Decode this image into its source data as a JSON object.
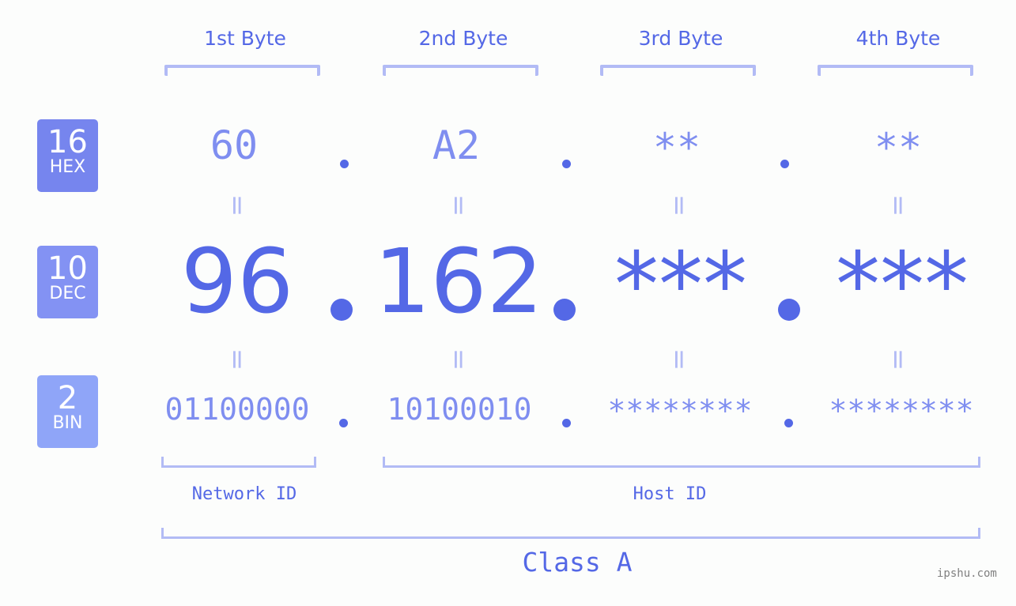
{
  "byte_headers": [
    "1st Byte",
    "2nd Byte",
    "3rd Byte",
    "4th Byte"
  ],
  "rows": {
    "hex": {
      "base": "16",
      "name": "HEX",
      "color": "#7685ee",
      "values": [
        "60",
        "A2",
        "**",
        "**"
      ]
    },
    "dec": {
      "base": "10",
      "name": "DEC",
      "color": "#8392f3",
      "values": [
        "96",
        "162",
        "***",
        "***"
      ]
    },
    "bin": {
      "base": "2",
      "name": "BIN",
      "color": "#8fa5f8",
      "values": [
        "01100000",
        "10100010",
        "********",
        "********"
      ]
    }
  },
  "equals_symbol": "=",
  "segments": {
    "network_id": "Network ID",
    "host_id": "Host ID"
  },
  "ip_class": "Class A",
  "watermark": "ipshu.com",
  "colors": {
    "accent": "#5468e6",
    "secondary": "#7f8ef0",
    "bracket": "#b2bbf5",
    "background": "#fcfdfc"
  }
}
